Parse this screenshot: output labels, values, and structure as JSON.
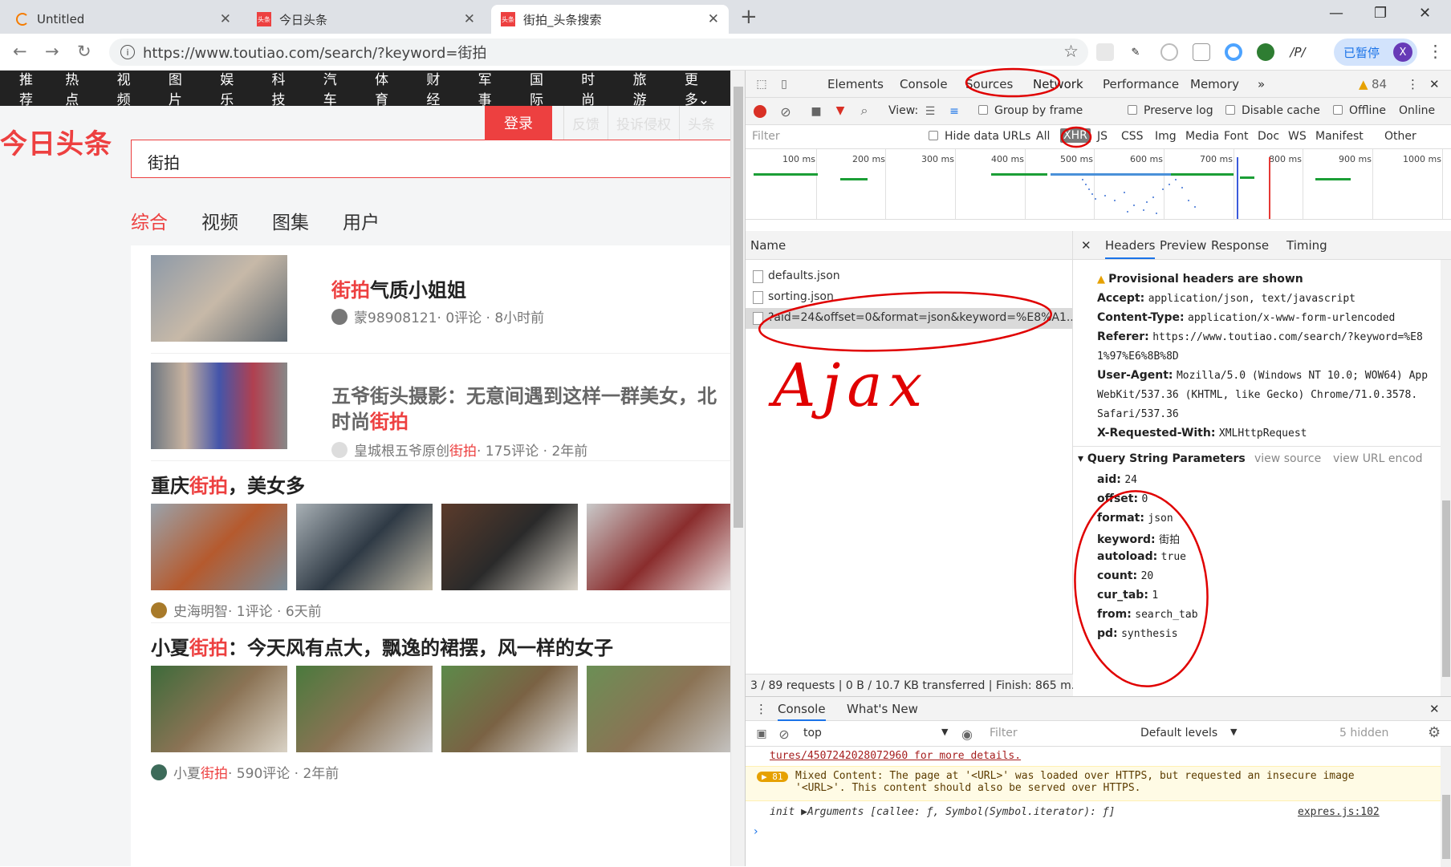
{
  "browser": {
    "tabs": [
      {
        "title": "Untitled",
        "fav": ""
      },
      {
        "title": "今日头条",
        "fav": "头条"
      },
      {
        "title": "街拍_头条搜索",
        "fav": "头条"
      }
    ],
    "url": "https://www.toutiao.com/search/?keyword=街拍",
    "paused_label": "已暂停",
    "avatar_letter": "X"
  },
  "page": {
    "categories": [
      "推荐",
      "热点",
      "视频",
      "图片",
      "娱乐",
      "科技",
      "汽车",
      "体育",
      "财经",
      "军事",
      "国际",
      "时尚",
      "旅游",
      "更多"
    ],
    "login_label": "登录",
    "ghost_links": [
      "反馈",
      "投诉侵权",
      "头条"
    ],
    "logo_text": "今日头条",
    "search_value": "街拍",
    "search_tabs": [
      "综合",
      "视频",
      "图集",
      "用户"
    ],
    "results": [
      {
        "title_hl": "街拍",
        "title_rest": "气质小姐姐",
        "author": "蒙98908121",
        "meta": " · 0评论 · 8小时前"
      },
      {
        "title_line1": "五爷街头摄影：无意间遇到这样一群美女，北",
        "title_line2_pre": "时尚",
        "title_line2_hl": "街拍",
        "author_pre": "皇城根五爷原创",
        "author_hl": "街拍",
        "meta": " · 175评论 · 2年前"
      },
      {
        "title_pre": "重庆",
        "title_hl": "街拍",
        "title_post": "，美女多",
        "author": "史海明智",
        "meta": " · 1评论 · 6天前"
      },
      {
        "title_pre": "小夏",
        "title_hl": "街拍",
        "title_post": "：今天风有点大，飘逸的裙摆，风一样的女子",
        "author_pre": "小夏",
        "author_hl": "街拍",
        "meta": " · 590评论 · 2年前"
      }
    ]
  },
  "devtools": {
    "panels": [
      "Elements",
      "Console",
      "Sources",
      "Network",
      "Performance",
      "Memory"
    ],
    "warning_count": "84",
    "toolbar": {
      "view": "View:",
      "group_by_frame": "Group by frame",
      "preserve_log": "Preserve log",
      "disable_cache": "Disable cache",
      "offline": "Offline",
      "online": "Online"
    },
    "filter": {
      "placeholder": "Filter",
      "hide_data_urls": "Hide data URLs",
      "types": [
        "All",
        "XHR",
        "JS",
        "CSS",
        "Img",
        "Media",
        "Font",
        "Doc",
        "WS",
        "Manifest",
        "Other"
      ]
    },
    "timeline_ticks": [
      "100 ms",
      "200 ms",
      "300 ms",
      "400 ms",
      "500 ms",
      "600 ms",
      "700 ms",
      "800 ms",
      "900 ms",
      "1000 ms"
    ],
    "name_header": "Name",
    "requests": [
      "defaults.json",
      "sorting.json",
      "?aid=24&offset=0&format=json&keyword=%E8%A1..."
    ],
    "annotation": "Ajax",
    "status": "3 / 89 requests  |  0 B / 10.7 KB transferred  |  Finish: 865 m...",
    "detail_tabs": [
      "Headers",
      "Preview",
      "Response",
      "Timing"
    ],
    "provisional": "Provisional headers are shown",
    "headers": [
      {
        "k": "Accept:",
        "v": "application/json, text/javascript"
      },
      {
        "k": "Content-Type:",
        "v": "application/x-www-form-urlencoded"
      },
      {
        "k": "Referer:",
        "v": "https://www.toutiao.com/search/?keyword=%E8"
      },
      {
        "k": "",
        "v": "1%97%E6%8B%8D"
      },
      {
        "k": "User-Agent:",
        "v": "Mozilla/5.0 (Windows NT 10.0; WOW64) App"
      },
      {
        "k": "",
        "v": "WebKit/537.36 (KHTML, like Gecko) Chrome/71.0.3578."
      },
      {
        "k": "",
        "v": "Safari/537.36"
      },
      {
        "k": "X-Requested-With:",
        "v": "XMLHttpRequest"
      }
    ],
    "qs_title": "Query String Parameters",
    "view_source": "view source",
    "view_url": "view URL encod",
    "params": [
      {
        "k": "aid:",
        "v": "24"
      },
      {
        "k": "offset:",
        "v": "0"
      },
      {
        "k": "format:",
        "v": "json"
      },
      {
        "k": "keyword:",
        "v": "街拍"
      },
      {
        "k": "autoload:",
        "v": "true"
      },
      {
        "k": "count:",
        "v": "20"
      },
      {
        "k": "cur_tab:",
        "v": "1"
      },
      {
        "k": "from:",
        "v": "search_tab"
      },
      {
        "k": "pd:",
        "v": "synthesis"
      }
    ],
    "drawer": {
      "tabs": [
        "Console",
        "What's New"
      ],
      "context": "top",
      "filter": "Filter",
      "levels": "Default levels",
      "hidden": "5 hidden",
      "log1": "tures/4507242028072960 for more details.",
      "badge": "81",
      "log2a": "Mixed Content: The page at '<URL>' was loaded over HTTPS, but requested an insecure image",
      "log2b": "'<URL>'. This content should also be served over HTTPS.",
      "log3": "init ▶Arguments [callee: ƒ, Symbol(Symbol.iterator): ƒ]",
      "log3_src": "expres.js:102"
    }
  },
  "colors": {
    "accent": "#ed4040",
    "annotation": "#e00000",
    "tab_blue": "#1a73e8"
  }
}
